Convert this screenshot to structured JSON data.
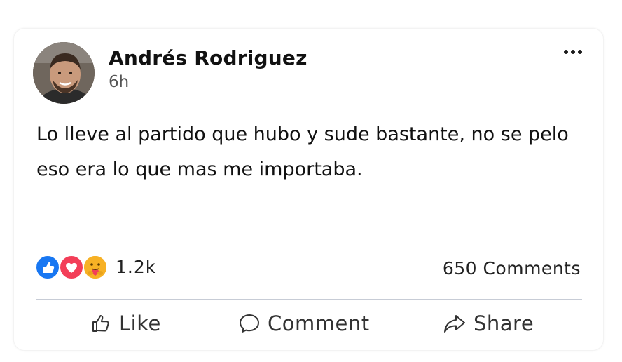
{
  "post": {
    "author": "Andrés Rodriguez",
    "time": "6h",
    "text": "Lo lleve al partido que hubo y sude bastante, no se pelo eso era lo que mas me importaba."
  },
  "stats": {
    "reactions_count": "1.2k",
    "comments_count": "650 Comments",
    "reaction_icons": [
      "like-icon",
      "love-icon",
      "care-icon"
    ]
  },
  "actions": {
    "like": "Like",
    "comment": "Comment",
    "share": "Share"
  },
  "colors": {
    "like": "#1877f2",
    "love": "#f33e58",
    "care": "#f7b125",
    "divider": "#c7ccd6"
  }
}
